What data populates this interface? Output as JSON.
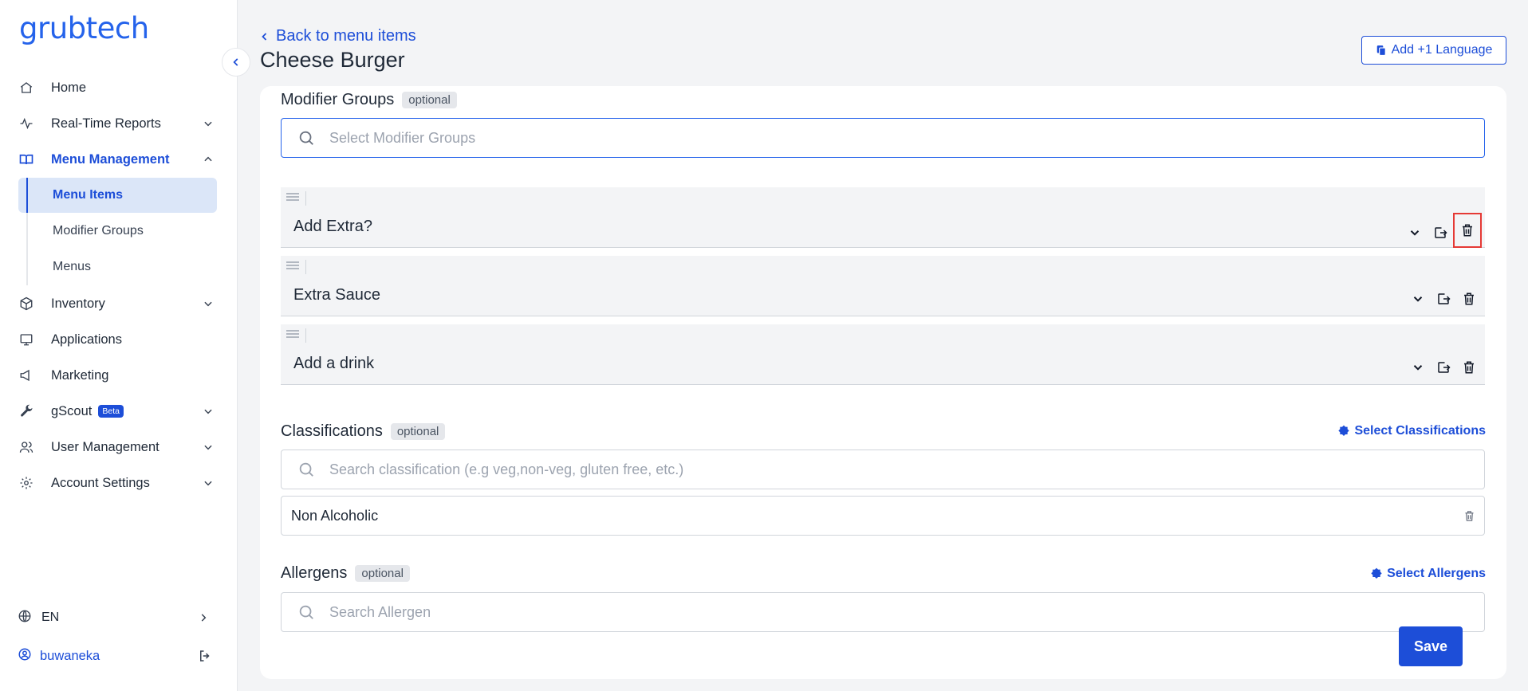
{
  "app": {
    "logo": "grubtech"
  },
  "sidebar": {
    "items": [
      {
        "label": "Home",
        "icon": "home-icon"
      },
      {
        "label": "Real-Time Reports",
        "icon": "activity-icon"
      },
      {
        "label": "Menu Management",
        "icon": "book-icon"
      },
      {
        "label": "Inventory",
        "icon": "box-icon"
      },
      {
        "label": "Applications",
        "icon": "monitor-icon"
      },
      {
        "label": "Marketing",
        "icon": "megaphone-icon"
      },
      {
        "label": "gScout",
        "icon": "wrench-icon",
        "badge": "Beta"
      },
      {
        "label": "User Management",
        "icon": "users-icon"
      },
      {
        "label": "Account Settings",
        "icon": "gear-icon"
      }
    ],
    "sub_items": [
      {
        "label": "Menu Items"
      },
      {
        "label": "Modifier Groups"
      },
      {
        "label": "Menus"
      }
    ],
    "language": "EN",
    "user": "buwaneka"
  },
  "header": {
    "back_label": "Back to menu items",
    "title": "Cheese Burger",
    "add_language_label": "Add +1 Language"
  },
  "modifier_groups": {
    "title": "Modifier Groups",
    "optional_label": "optional",
    "search_placeholder": "Select Modifier Groups",
    "items": [
      {
        "name": "Add Extra?"
      },
      {
        "name": "Extra Sauce"
      },
      {
        "name": "Add a drink"
      }
    ]
  },
  "classifications": {
    "title": "Classifications",
    "optional_label": "optional",
    "select_label": "Select Classifications",
    "search_placeholder": "Search classification (e.g veg,non-veg, gluten free, etc.)",
    "items": [
      {
        "name": "Non Alcoholic"
      }
    ]
  },
  "allergens": {
    "title": "Allergens",
    "optional_label": "optional",
    "select_label": "Select Allergens",
    "search_placeholder": "Search Allergen"
  },
  "footer": {
    "save_label": "Save"
  },
  "colors": {
    "accent": "#1d4ed8",
    "highlight": "#e53935",
    "page_bg": "#f3f4f6"
  }
}
